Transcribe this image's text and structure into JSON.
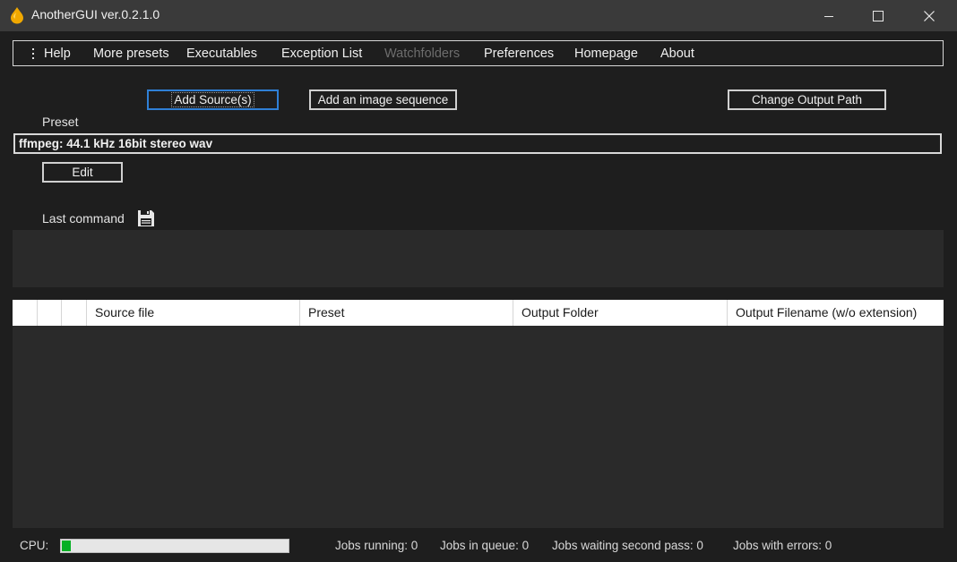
{
  "window": {
    "title": "AnotherGUI ver.0.2.1.0"
  },
  "menu": {
    "items": [
      {
        "label": "Help"
      },
      {
        "label": "More presets"
      },
      {
        "label": "Executables"
      },
      {
        "label": "Exception List"
      },
      {
        "label": "Watchfolders",
        "disabled": true
      },
      {
        "label": "Preferences"
      },
      {
        "label": "Homepage"
      },
      {
        "label": "About"
      }
    ]
  },
  "toolbar": {
    "add_sources_label": "Add Source(s)",
    "add_sequence_label": "Add an image sequence",
    "change_output_label": "Change Output Path"
  },
  "preset": {
    "label": "Preset",
    "value": "ffmpeg: 44.1 kHz 16bit stereo wav",
    "edit_label": "Edit"
  },
  "last_command": {
    "label": "Last command",
    "icon": "save-icon",
    "value": ""
  },
  "job_table": {
    "columns": [
      "",
      "",
      "",
      "Source file",
      "Preset",
      "Output Folder",
      "Output Filename (w/o extension)"
    ],
    "rows": []
  },
  "status": {
    "cpu_label": "CPU:",
    "cpu_fraction": 0.04,
    "jobs_running": "Jobs running:  0",
    "jobs_in_queue": "Jobs in queue:  0",
    "jobs_waiting": "Jobs waiting second pass:  0",
    "jobs_errors": "Jobs with errors:  0"
  },
  "colors": {
    "background": "#1e1e1e",
    "titlebar": "#3a3a3a",
    "focus_border": "#2f80d6",
    "cpu_fill": "#06b025"
  }
}
